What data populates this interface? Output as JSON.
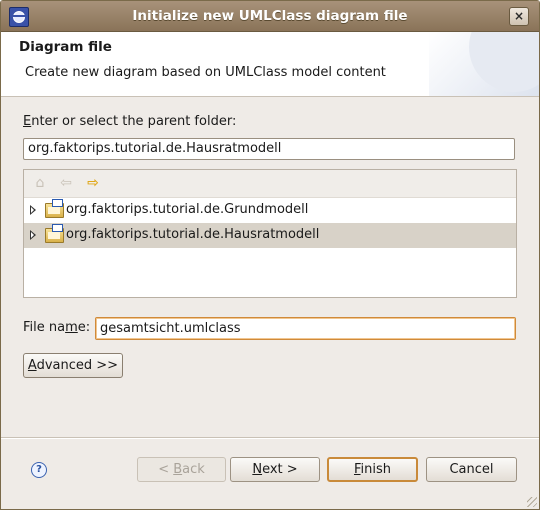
{
  "window": {
    "title": "Initialize new UMLClass diagram file",
    "close_label": "×"
  },
  "header": {
    "title": "Diagram file",
    "description": "Create new diagram based on UMLClass model content"
  },
  "folder": {
    "label_mnemonic": "E",
    "label_rest": "nter or select the parent folder:",
    "value": "org.faktorips.tutorial.de.Hausratmodell"
  },
  "tree": {
    "toolbar": {
      "home_icon": "⌂",
      "back_icon": "⇦",
      "forward_icon": "⇨"
    },
    "items": [
      {
        "label": "org.faktorips.tutorial.de.Grundmodell",
        "selected": false
      },
      {
        "label": "org.faktorips.tutorial.de.Hausratmodell",
        "selected": true
      }
    ]
  },
  "file": {
    "label_pre": "File na",
    "label_mnemonic": "m",
    "label_post": "e:",
    "value": "gesamtsicht.umlclass"
  },
  "buttons": {
    "advanced_mnemonic": "A",
    "advanced_rest": "dvanced >>",
    "back_pre": "< ",
    "back_mnemonic": "B",
    "back_rest": "ack",
    "next_mnemonic": "N",
    "next_rest": "ext >",
    "finish_mnemonic": "F",
    "finish_rest": "inish",
    "cancel": "Cancel"
  },
  "help_icon": "?",
  "colors": {
    "titlebar": "#9c8468",
    "selection": "#d8d2c8",
    "focus_border": "#d08a3a"
  }
}
